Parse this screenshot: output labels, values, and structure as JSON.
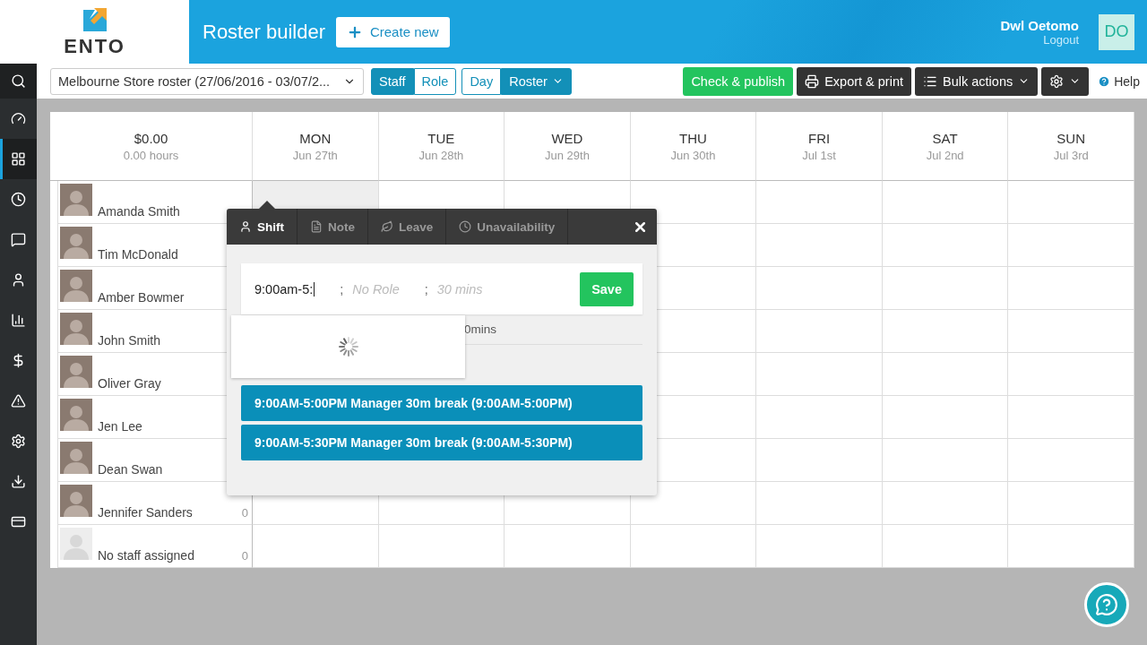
{
  "header": {
    "logo": "ENTO",
    "title": "Roster builder",
    "create_button": "Create new",
    "user_name": "Dwl Oetomo",
    "logout": "Logout",
    "initials": "DO"
  },
  "toolbar": {
    "roster_select": "Melbourne Store roster (27/06/2016 - 03/07/2...",
    "view_toggle": [
      {
        "label": "Staff",
        "selected": true
      },
      {
        "label": "Role",
        "selected": false
      }
    ],
    "mode_toggle": [
      {
        "label": "Day",
        "selected": false,
        "dropdown": false
      },
      {
        "label": "Roster",
        "selected": true,
        "dropdown": true
      }
    ],
    "check_publish": "Check & publish",
    "export_print": "Export & print",
    "bulk_actions": "Bulk actions",
    "help": "Help"
  },
  "sidebar": [
    {
      "kind": "search",
      "selected": false
    },
    {
      "kind": "dashboard",
      "selected": false
    },
    {
      "kind": "roster",
      "selected": true
    },
    {
      "kind": "clock",
      "selected": false
    },
    {
      "kind": "messages",
      "selected": false
    },
    {
      "kind": "people",
      "selected": false
    },
    {
      "kind": "reports",
      "selected": false
    },
    {
      "kind": "pay",
      "selected": false
    },
    {
      "kind": "alerts",
      "selected": false
    },
    {
      "kind": "settings",
      "selected": false
    },
    {
      "kind": "import",
      "selected": false
    },
    {
      "kind": "billing",
      "selected": false
    }
  ],
  "grid": {
    "total_cost": "$0.00",
    "total_hours": "0.00 hours",
    "days": [
      {
        "day": "MON",
        "date": "Jun 27th"
      },
      {
        "day": "TUE",
        "date": "Jun 28th"
      },
      {
        "day": "WED",
        "date": "Jun 29th"
      },
      {
        "day": "THU",
        "date": "Jun 30th"
      },
      {
        "day": "FRI",
        "date": "Jul 1st"
      },
      {
        "day": "SAT",
        "date": "Jul 2nd"
      },
      {
        "day": "SUN",
        "date": "Jul 3rd"
      }
    ],
    "staff": [
      {
        "name": "Amanda Smith",
        "kind": "photo"
      },
      {
        "name": "Tim McDonald",
        "kind": "photo"
      },
      {
        "name": "Amber Bowmer",
        "kind": "photo"
      },
      {
        "name": "John Smith",
        "kind": "photo"
      },
      {
        "name": "Oliver Gray",
        "kind": "photo"
      },
      {
        "name": "Jen Lee",
        "kind": "photo"
      },
      {
        "name": "Dean Swan",
        "kind": "photo"
      },
      {
        "name": "Jennifer Sanders",
        "kind": "photo",
        "hours": "0"
      },
      {
        "name": "No staff assigned",
        "kind": "empty",
        "hours": "0"
      }
    ]
  },
  "popup": {
    "tabs": [
      {
        "label": "Shift",
        "kind": "shift",
        "selected": true
      },
      {
        "label": "Note",
        "kind": "note",
        "selected": false
      },
      {
        "label": "Leave",
        "kind": "leave",
        "selected": false
      },
      {
        "label": "Unavailability",
        "kind": "unavailability",
        "selected": false
      }
    ],
    "shift_value": "9:00am-5:",
    "separators": [
      ";",
      ";"
    ],
    "role_placeholder": "No Role",
    "break_placeholder": "30 mins",
    "save": "Save",
    "hint": "0mins",
    "loading": true,
    "suggestions": [
      "9:00AM-5:00PM Manager 30m break (9:00AM-5:00PM)",
      "9:00AM-5:30PM Manager 30m break (9:00AM-5:30PM)"
    ]
  }
}
